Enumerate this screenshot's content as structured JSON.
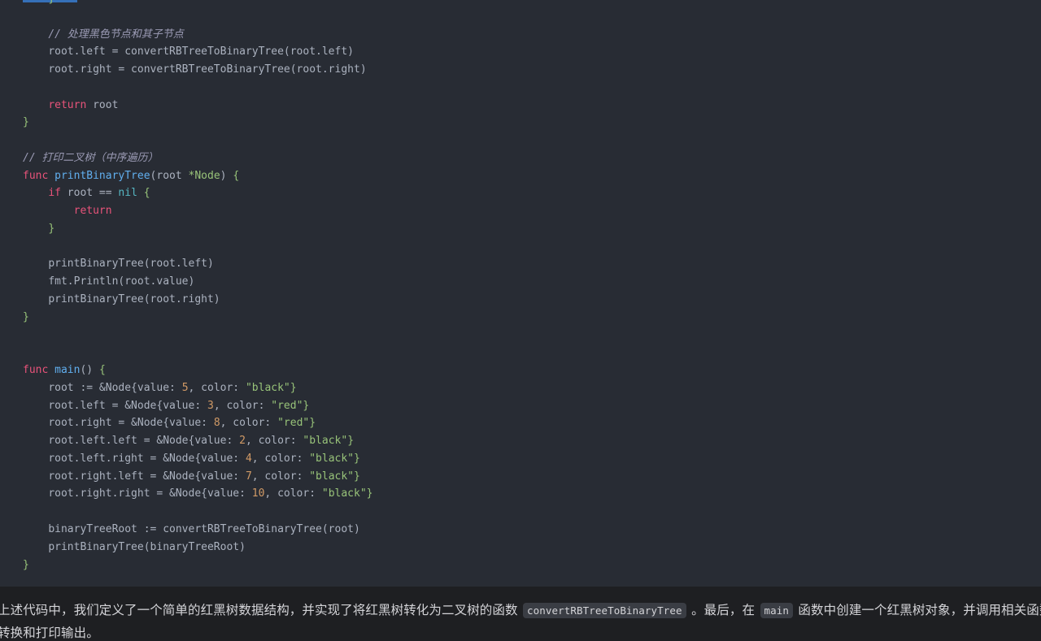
{
  "theme": {
    "code_bg": "#282c34",
    "page_bg": "#1e1f22",
    "default_text": "#abb2bf",
    "keyword": "#e8537a",
    "function": "#61afef",
    "type": "#98c379",
    "string": "#98c379",
    "number": "#d19a66",
    "builtin": "#56b6c2",
    "comment": "#9b9bb5",
    "selection": "#3570b8",
    "inline_code_bg": "#3a3d44",
    "prose_text": "#d4d4d8"
  },
  "code": {
    "language": "go",
    "lines": [
      {
        "indent": 1,
        "tokens": [
          {
            "t": "}",
            "c": "brace"
          }
        ]
      },
      {
        "indent": 0,
        "tokens": []
      },
      {
        "indent": 1,
        "tokens": [
          {
            "t": "// 处理黑色节点和其子节点",
            "c": "com"
          }
        ]
      },
      {
        "indent": 1,
        "tokens": [
          {
            "t": "root.left = convertRBTreeToBinaryTree(root.left)",
            "c": "plain"
          }
        ]
      },
      {
        "indent": 1,
        "tokens": [
          {
            "t": "root.right = convertRBTreeToBinaryTree(root.right)",
            "c": "plain"
          }
        ]
      },
      {
        "indent": 0,
        "tokens": []
      },
      {
        "indent": 1,
        "tokens": [
          {
            "t": "return",
            "c": "kw"
          },
          {
            "t": " root",
            "c": "plain"
          }
        ]
      },
      {
        "indent": 0,
        "tokens": [
          {
            "t": "}",
            "c": "brace"
          }
        ]
      },
      {
        "indent": 0,
        "tokens": []
      },
      {
        "indent": 0,
        "tokens": [
          {
            "t": "// 打印二叉树（中序遍历）",
            "c": "com"
          }
        ]
      },
      {
        "indent": 0,
        "tokens": [
          {
            "t": "func",
            "c": "kw"
          },
          {
            "t": " ",
            "c": "plain"
          },
          {
            "t": "printBinaryTree",
            "c": "fn"
          },
          {
            "t": "(root ",
            "c": "plain"
          },
          {
            "t": "*Node",
            "c": "type"
          },
          {
            "t": ") ",
            "c": "plain"
          },
          {
            "t": "{",
            "c": "brace"
          }
        ]
      },
      {
        "indent": 1,
        "tokens": [
          {
            "t": "if",
            "c": "kw"
          },
          {
            "t": " root == ",
            "c": "plain"
          },
          {
            "t": "nil",
            "c": "nil"
          },
          {
            "t": " ",
            "c": "plain"
          },
          {
            "t": "{",
            "c": "brace"
          }
        ]
      },
      {
        "indent": 2,
        "tokens": [
          {
            "t": "return",
            "c": "kw"
          }
        ]
      },
      {
        "indent": 1,
        "tokens": [
          {
            "t": "}",
            "c": "brace"
          }
        ]
      },
      {
        "indent": 0,
        "tokens": []
      },
      {
        "indent": 1,
        "tokens": [
          {
            "t": "printBinaryTree(root.left)",
            "c": "plain"
          }
        ]
      },
      {
        "indent": 1,
        "tokens": [
          {
            "t": "fmt.Println(root.value)",
            "c": "plain"
          }
        ]
      },
      {
        "indent": 1,
        "tokens": [
          {
            "t": "printBinaryTree(root.right)",
            "c": "plain"
          }
        ]
      },
      {
        "indent": 0,
        "tokens": [
          {
            "t": "}",
            "c": "brace"
          }
        ]
      },
      {
        "indent": 0,
        "tokens": []
      },
      {
        "indent": 0,
        "tokens": []
      },
      {
        "indent": 0,
        "tokens": [
          {
            "t": "func",
            "c": "kw"
          },
          {
            "t": " ",
            "c": "plain"
          },
          {
            "t": "main",
            "c": "fn"
          },
          {
            "t": "() ",
            "c": "plain"
          },
          {
            "t": "{",
            "c": "brace"
          }
        ]
      },
      {
        "indent": 1,
        "tokens": [
          {
            "t": "root := &Node{value: ",
            "c": "plain"
          },
          {
            "t": "5",
            "c": "num"
          },
          {
            "t": ", color: ",
            "c": "plain"
          },
          {
            "t": "\"black\"",
            "c": "str"
          },
          {
            "t": "}",
            "c": "brace"
          }
        ]
      },
      {
        "indent": 1,
        "tokens": [
          {
            "t": "root.left = &Node{value: ",
            "c": "plain"
          },
          {
            "t": "3",
            "c": "num"
          },
          {
            "t": ", color: ",
            "c": "plain"
          },
          {
            "t": "\"red\"",
            "c": "str"
          },
          {
            "t": "}",
            "c": "brace"
          }
        ]
      },
      {
        "indent": 1,
        "tokens": [
          {
            "t": "root.right = &Node{value: ",
            "c": "plain"
          },
          {
            "t": "8",
            "c": "num"
          },
          {
            "t": ", color: ",
            "c": "plain"
          },
          {
            "t": "\"red\"",
            "c": "str"
          },
          {
            "t": "}",
            "c": "brace"
          }
        ]
      },
      {
        "indent": 1,
        "tokens": [
          {
            "t": "root.left.left = &Node{value: ",
            "c": "plain"
          },
          {
            "t": "2",
            "c": "num"
          },
          {
            "t": ", color: ",
            "c": "plain"
          },
          {
            "t": "\"black\"",
            "c": "str"
          },
          {
            "t": "}",
            "c": "brace"
          }
        ]
      },
      {
        "indent": 1,
        "tokens": [
          {
            "t": "root.left.right = &Node{value: ",
            "c": "plain"
          },
          {
            "t": "4",
            "c": "num"
          },
          {
            "t": ", color: ",
            "c": "plain"
          },
          {
            "t": "\"black\"",
            "c": "str"
          },
          {
            "t": "}",
            "c": "brace"
          }
        ]
      },
      {
        "indent": 1,
        "tokens": [
          {
            "t": "root.right.left = &Node{value: ",
            "c": "plain"
          },
          {
            "t": "7",
            "c": "num"
          },
          {
            "t": ", color: ",
            "c": "plain"
          },
          {
            "t": "\"black\"",
            "c": "str"
          },
          {
            "t": "}",
            "c": "brace"
          }
        ]
      },
      {
        "indent": 1,
        "tokens": [
          {
            "t": "root.right.right = &Node{value: ",
            "c": "plain"
          },
          {
            "t": "10",
            "c": "num"
          },
          {
            "t": ", color: ",
            "c": "plain"
          },
          {
            "t": "\"black\"",
            "c": "str"
          },
          {
            "t": "}",
            "c": "brace"
          }
        ]
      },
      {
        "indent": 0,
        "tokens": []
      },
      {
        "indent": 1,
        "tokens": [
          {
            "t": "binaryTreeRoot := convertRBTreeToBinaryTree(root)",
            "c": "plain"
          }
        ]
      },
      {
        "indent": 1,
        "tokens": [
          {
            "t": "printBinaryTree(binaryTreeRoot)",
            "c": "plain"
          }
        ]
      },
      {
        "indent": 0,
        "tokens": [
          {
            "t": "}",
            "c": "brace"
          }
        ]
      }
    ]
  },
  "prose": {
    "line1": [
      {
        "type": "text",
        "t": "上述代码中，我们定义了一个简单的红黑树数据结构，并实现了将红黑树转化为二叉树的函数 "
      },
      {
        "type": "code",
        "t": "convertRBTreeToBinaryTree"
      },
      {
        "type": "text",
        "t": " 。最后，在 "
      },
      {
        "type": "code",
        "t": "main"
      },
      {
        "type": "text",
        "t": " 函数中创建一个红黑树对象，并调用相关函数进行"
      }
    ],
    "line2": [
      {
        "type": "text",
        "t": "转换和打印输出。"
      }
    ]
  }
}
